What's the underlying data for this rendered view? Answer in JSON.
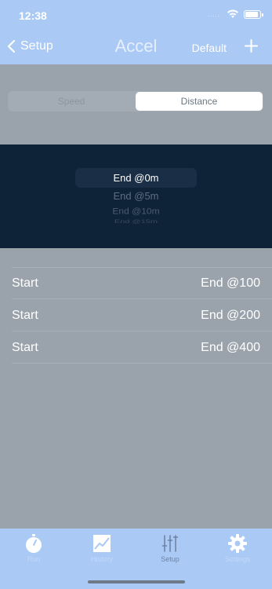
{
  "status_bar": {
    "time": "12:38",
    "signal_dots": "....."
  },
  "nav": {
    "back_label": "Setup",
    "title": "Accel",
    "default_label": "Default"
  },
  "segments": [
    {
      "label": "Speed",
      "selected": false
    },
    {
      "label": "Distance",
      "selected": true
    }
  ],
  "picker": {
    "options": [
      "End @0m",
      "End @5m",
      "End @10m",
      "End @15m"
    ],
    "selected": "End @0m"
  },
  "rows": [
    {
      "left": "Start",
      "right": "End @100"
    },
    {
      "left": "Start",
      "right": "End @200"
    },
    {
      "left": "Start",
      "right": "End @400"
    }
  ],
  "tabs": [
    {
      "label": "Run",
      "icon": "stopwatch-icon",
      "active": false
    },
    {
      "label": "History",
      "icon": "chart-icon",
      "active": false
    },
    {
      "label": "Setup",
      "icon": "sliders-icon",
      "active": true
    },
    {
      "label": "Settings",
      "icon": "gear-icon",
      "active": false
    }
  ],
  "colors": {
    "accent_bar": "#aac9f5",
    "background": "#9aa3ab",
    "picker_bg": "#0e2238"
  }
}
